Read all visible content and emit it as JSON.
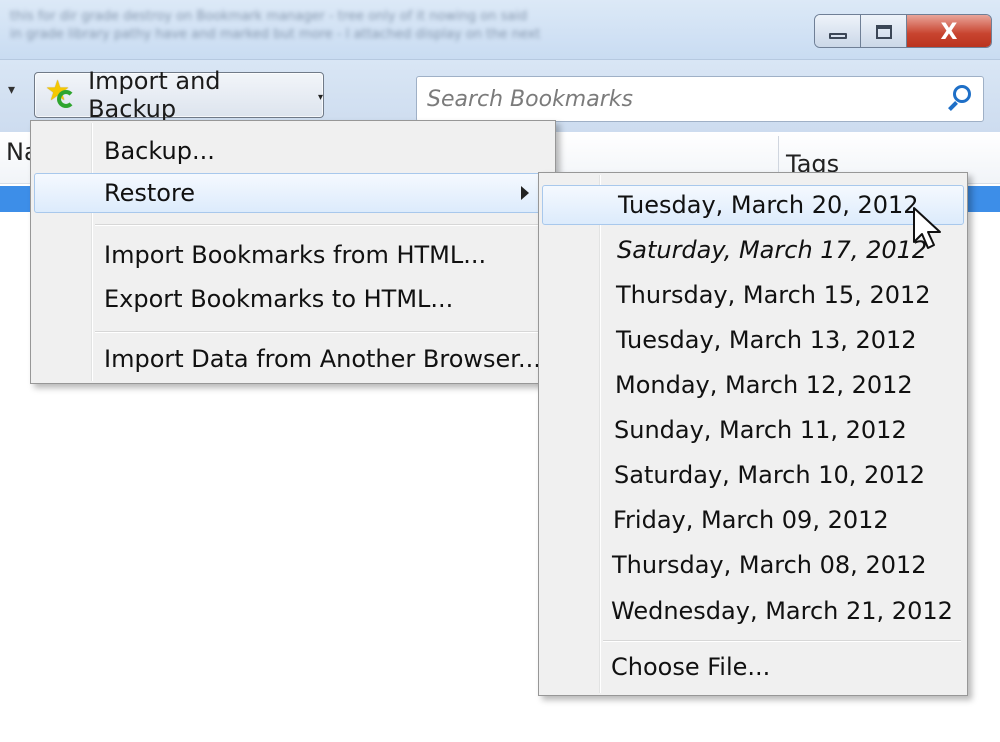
{
  "window": {
    "blurred_text_line1": "this for dir grade destroy on Bookmark manager - tree only of it nowing on said",
    "blurred_text_line2": "in grade library pathy have and marked but more - I attached display on the next",
    "close_glyph": "X"
  },
  "toolbar": {
    "back_arrow": "▾",
    "import_backup_label": "Import and Backup",
    "import_backup_arrow": "▾",
    "search_placeholder": "Search Bookmarks"
  },
  "columns": {
    "name": "Na",
    "tags": "Tags"
  },
  "main_menu": {
    "items": [
      {
        "label": "Backup...",
        "accel": "B"
      },
      {
        "label": "Restore",
        "accel": "R",
        "has_submenu": true,
        "highlighted": true
      },
      {
        "label": "Import Bookmarks from HTML...",
        "accel": "I"
      },
      {
        "label": "Export Bookmarks to HTML...",
        "accel": "E"
      },
      {
        "label": "Import Data from Another Browser...",
        "accel": "A"
      }
    ]
  },
  "restore_menu": {
    "items": [
      {
        "label": "Tuesday, March 20, 2012",
        "highlighted": true
      },
      {
        "label": "Saturday, March 17, 2012",
        "italic": true
      },
      {
        "label": "Thursday, March 15, 2012"
      },
      {
        "label": "Tuesday, March 13, 2012"
      },
      {
        "label": "Monday, March 12, 2012"
      },
      {
        "label": "Sunday, March 11, 2012"
      },
      {
        "label": "Saturday, March 10, 2012"
      },
      {
        "label": "Friday, March 09, 2012"
      },
      {
        "label": "Thursday, March 08, 2012"
      },
      {
        "label": "Wednesday, March 21, 2012"
      }
    ],
    "choose_file": "Choose File..."
  },
  "colors": {
    "accent": "#3d8ee8",
    "menu_bg": "#f0f0f0",
    "hover_border": "#a8c8ec",
    "close_button": "#c8442f"
  }
}
